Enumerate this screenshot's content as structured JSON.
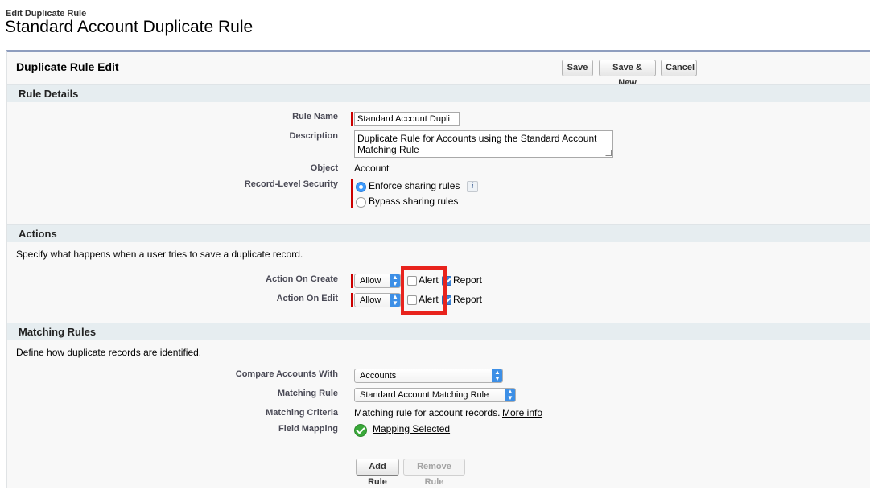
{
  "page": {
    "pre_title": "Edit Duplicate Rule",
    "title": "Standard Account Duplicate Rule"
  },
  "panel": {
    "title": "Duplicate Rule Edit",
    "buttons": {
      "save": "Save",
      "save_new": "Save & New",
      "cancel": "Cancel"
    }
  },
  "rule_details": {
    "header": "Rule Details",
    "rule_name": {
      "label": "Rule Name",
      "value": "Standard Account Dupli"
    },
    "description": {
      "label": "Description",
      "value": "Duplicate Rule for Accounts using the Standard Account Matching Rule"
    },
    "object": {
      "label": "Object",
      "value": "Account"
    },
    "record_security": {
      "label": "Record-Level Security",
      "options": [
        "Enforce sharing rules",
        "Bypass sharing rules"
      ],
      "selected": "Enforce sharing rules",
      "info_icon": "info-icon"
    }
  },
  "actions": {
    "header": "Actions",
    "description": "Specify what happens when a user tries to save a duplicate record.",
    "on_create": {
      "label": "Action On Create",
      "value": "Allow",
      "alert_label": "Alert",
      "alert_checked": false,
      "report_label": "Report",
      "report_checked": true
    },
    "on_edit": {
      "label": "Action On Edit",
      "value": "Allow",
      "alert_label": "Alert",
      "alert_checked": false,
      "report_label": "Report",
      "report_checked": true
    }
  },
  "matching_rules": {
    "header": "Matching Rules",
    "description": "Define how duplicate records are identified.",
    "compare_with": {
      "label": "Compare Accounts With",
      "value": "Accounts"
    },
    "matching_rule": {
      "label": "Matching Rule",
      "value": "Standard Account Matching Rule"
    },
    "criteria": {
      "label": "Matching Criteria",
      "value": "Matching rule for account records.",
      "link": "More info"
    },
    "field_mapping": {
      "label": "Field Mapping",
      "link": "Mapping Selected"
    },
    "buttons": {
      "add": "Add Rule",
      "remove": "Remove Rule"
    }
  },
  "colors": {
    "required_bar": "#cc0000",
    "highlight": "#e8231d",
    "section_bg": "#e6edf0",
    "accent_blue": "#3b82d6"
  }
}
